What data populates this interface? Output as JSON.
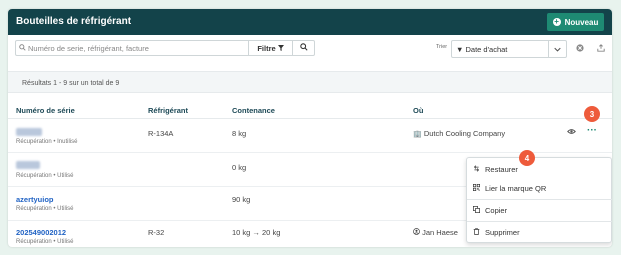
{
  "header": {
    "title": "Bouteilles de réfrigérant",
    "new_button": "Nouveau"
  },
  "toolbar": {
    "search_placeholder": "Numéro de serie, réfrigérant, facture",
    "filter_label": "Filtre",
    "sort_label": "Trier",
    "sort_value": "▼ Date d'achat"
  },
  "results_text": "Résultats 1 - 9 sur un total de 9",
  "columns": [
    "Numéro de série",
    "Réfrigérant",
    "Contenance",
    "Où"
  ],
  "rows": [
    {
      "serial": "",
      "status": "Récupération • Inutilisé",
      "refrigerant": "R-134A",
      "capacity": "8 kg",
      "location": "Dutch Cooling Company"
    },
    {
      "serial": "",
      "status": "Récupération • Utilisé",
      "refrigerant": "",
      "capacity": "0 kg",
      "location": ""
    },
    {
      "serial": "azertyuiop",
      "status": "Récupération • Utilisé",
      "refrigerant": "",
      "capacity": "90 kg",
      "location": ""
    },
    {
      "serial": "202549002012",
      "status": "Récupération • Utilisé",
      "refrigerant": "R-32",
      "capacity": "10 kg → 20 kg",
      "location": "Jan Haese"
    }
  ],
  "menu": {
    "restore": "Restaurer",
    "link_qr": "Lier la marque QR",
    "copy": "Copier",
    "delete": "Supprimer"
  },
  "badges": {
    "step3": "3",
    "step4": "4"
  },
  "colors": {
    "header_bg": "#13434a",
    "accent_green": "#1e8a73",
    "badge": "#ee5b3b",
    "link": "#2163c4"
  }
}
